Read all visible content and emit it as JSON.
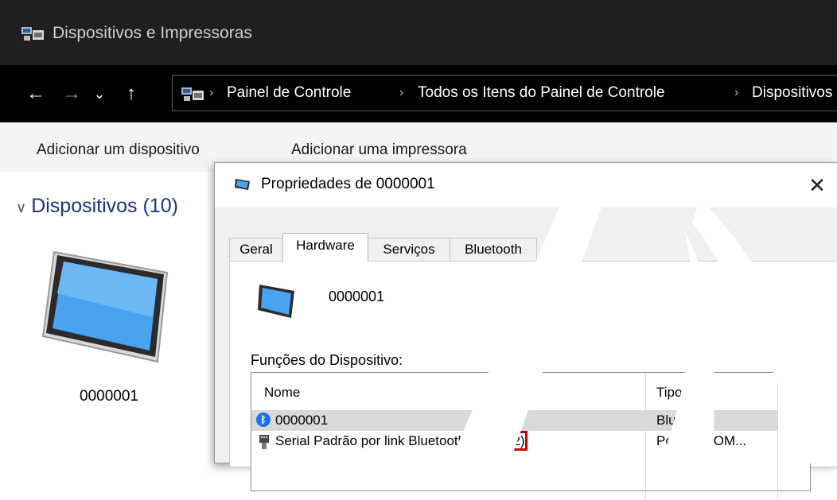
{
  "window": {
    "title": "Dispositivos e Impressoras"
  },
  "address": {
    "back_icon": "←",
    "forward_icon": "→",
    "recent_icon": "⌄",
    "up_icon": "↑",
    "crumbs": [
      "Painel de Controle",
      "Todos os Itens do Painel de Controle",
      "Dispositivos"
    ],
    "separator": "›"
  },
  "toolbar": {
    "add_device": "Adicionar um dispositivo",
    "add_printer": "Adicionar uma impressora"
  },
  "devices": {
    "group_header": "Dispositivos (10)",
    "collapse_glyph": "∨",
    "items": [
      {
        "label": "0000001"
      }
    ]
  },
  "dialog": {
    "title": "Propriedades de 0000001",
    "close_glyph": "✕",
    "tabs": [
      {
        "label": "Geral",
        "active": false
      },
      {
        "label": "Hardware",
        "active": true
      },
      {
        "label": "Serviços",
        "active": false
      },
      {
        "label": "Bluetooth",
        "active": false
      }
    ],
    "device_name": "0000001",
    "functions_label": "Funções do Dispositivo:",
    "columns": {
      "name": "Nome",
      "type": "Tipo"
    },
    "rows": [
      {
        "icon": "bluetooth-icon",
        "name": "0000001",
        "type": "Bluetooth",
        "selected": true
      },
      {
        "icon": "serial-port-icon",
        "name_prefix": "Serial Padrão por link Bluetooth ",
        "name_highlight": "(COM12)",
        "type": "Portas (COM..."
      }
    ]
  },
  "colors": {
    "titlebar_bg": "#1f1f1f",
    "addressbar_bg": "#000000",
    "group_header": "#1e3287",
    "highlight_box": "#d00000"
  }
}
